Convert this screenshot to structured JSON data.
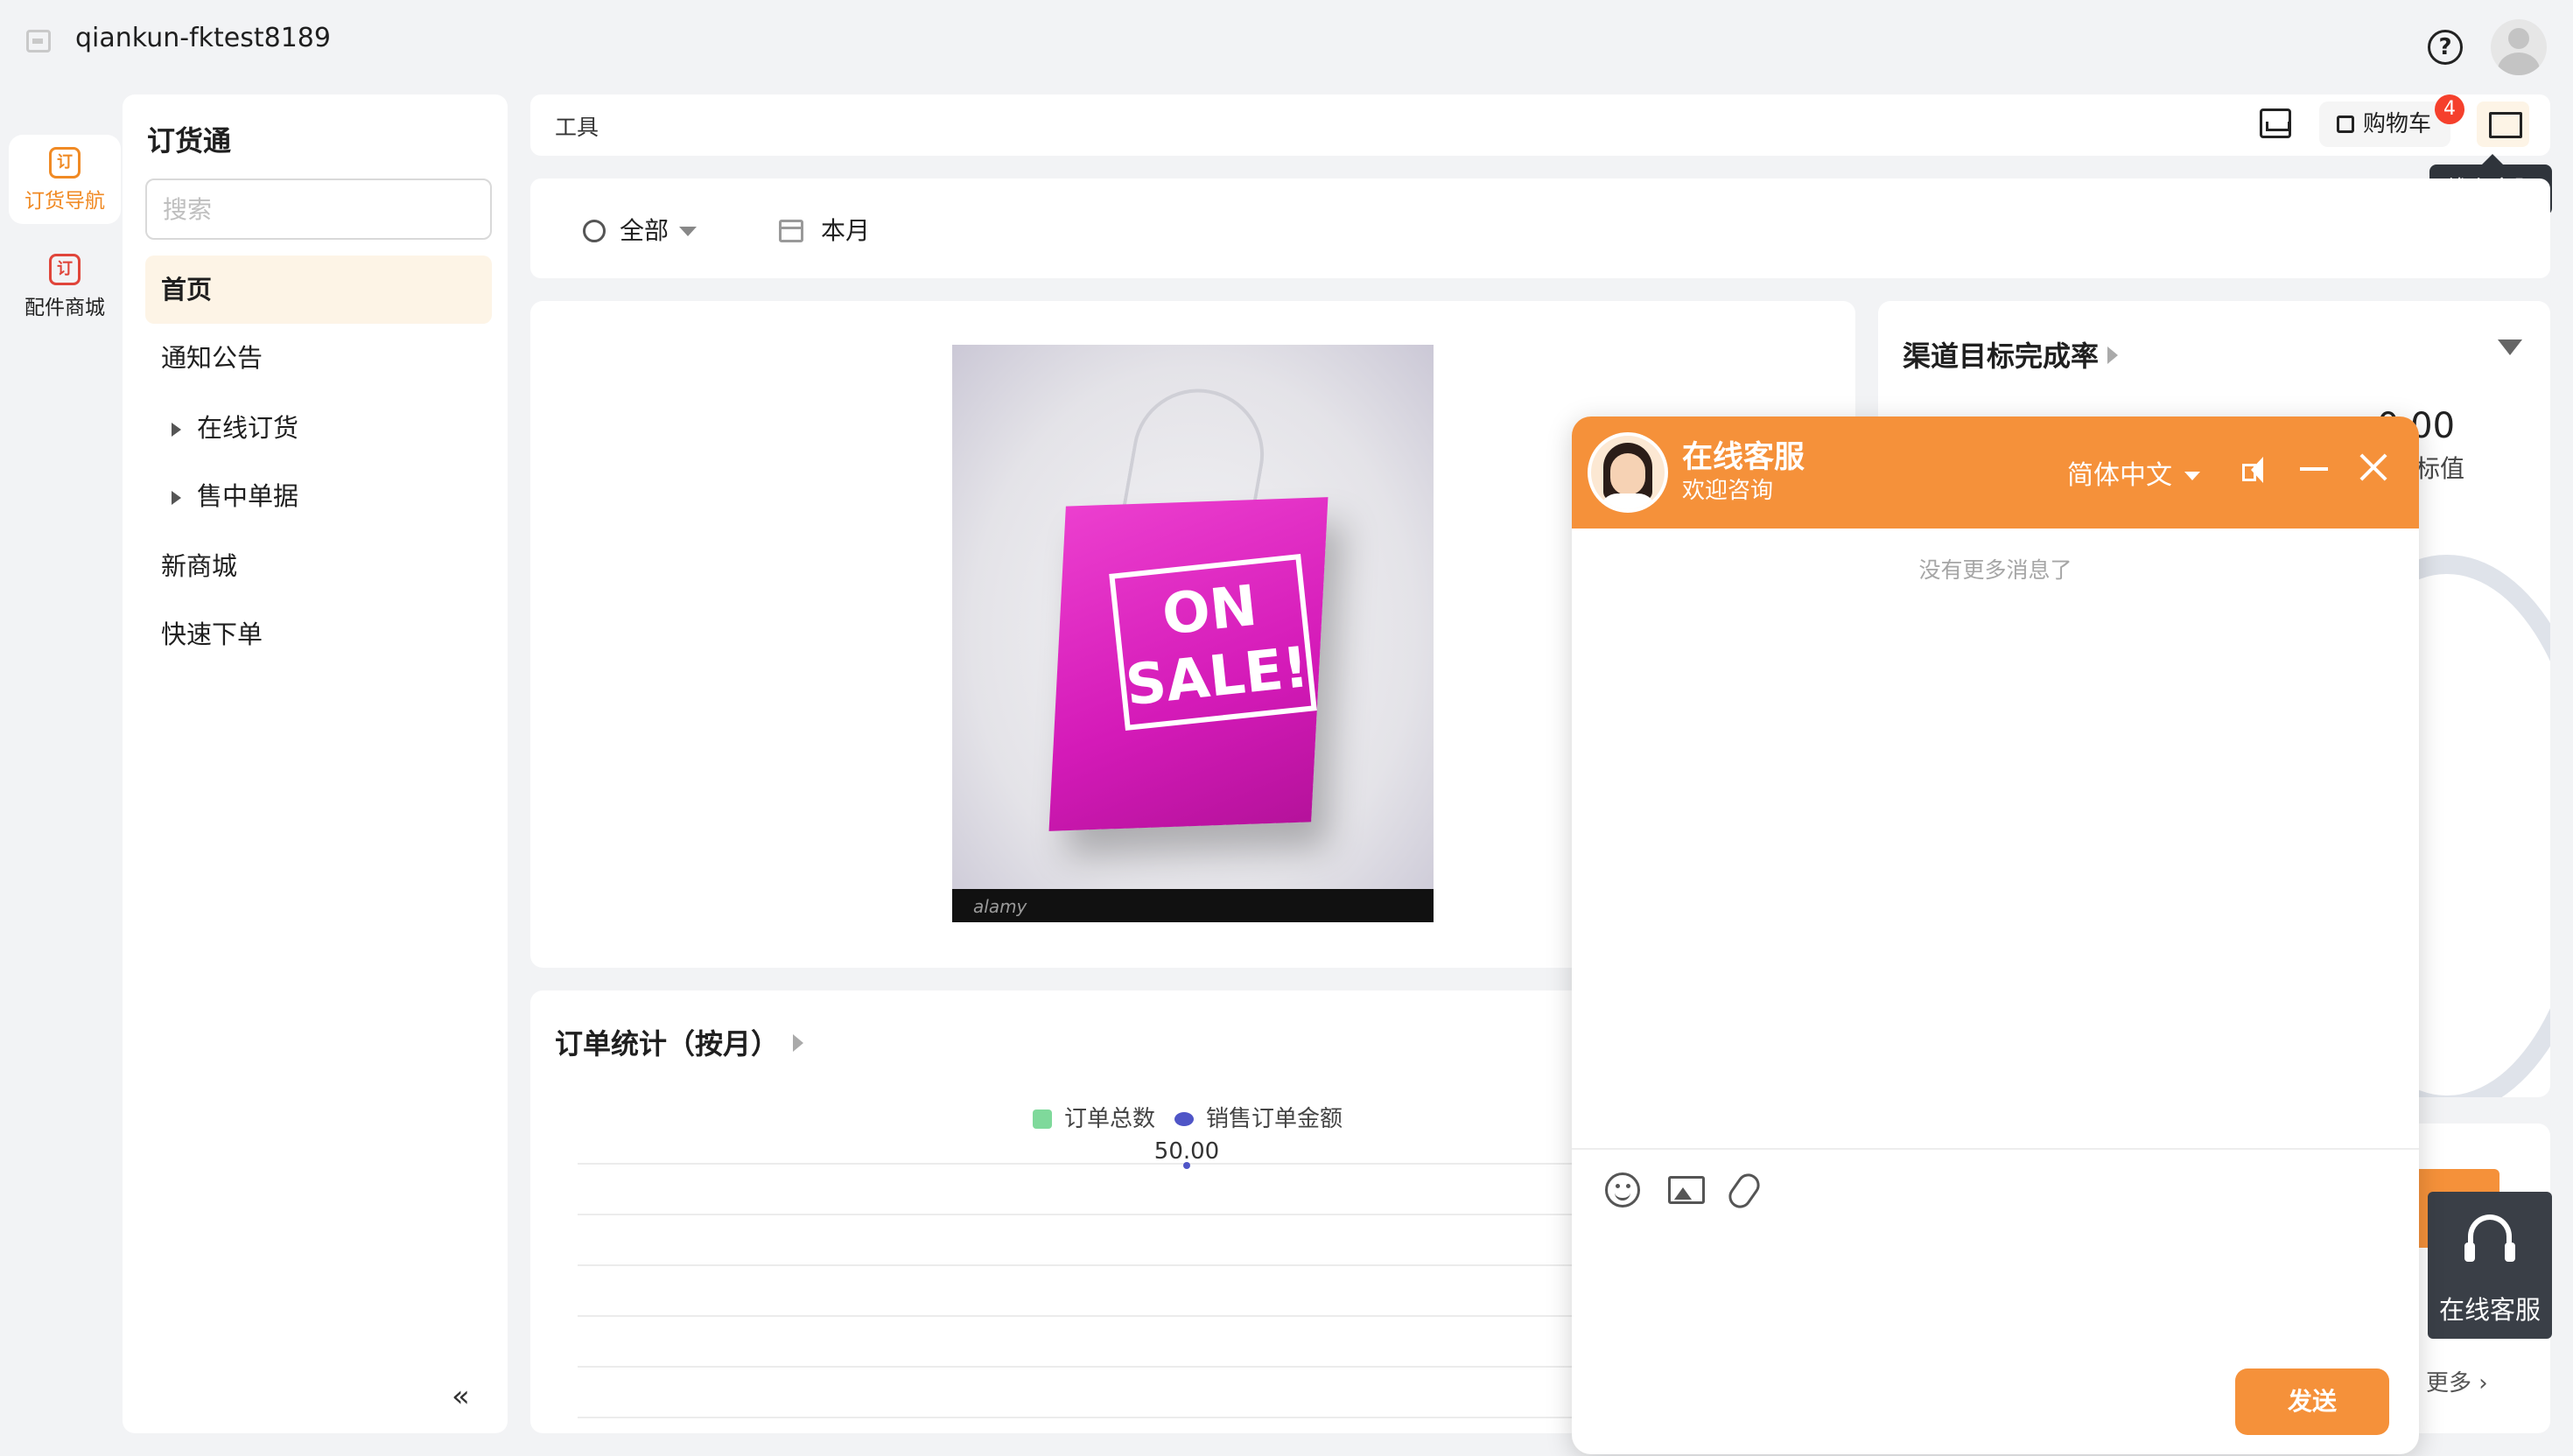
{
  "app": {
    "title": "qiankun-fktest8189"
  },
  "rail": {
    "items": [
      {
        "label": "订货导航",
        "icon": "order-nav-icon",
        "active": true
      },
      {
        "label": "配件商城",
        "icon": "parts-mall-icon",
        "active": false
      }
    ],
    "icon_glyph": "订"
  },
  "nav": {
    "title": "订货通",
    "search_placeholder": "搜索",
    "items": [
      {
        "label": "首页",
        "active": true
      },
      {
        "label": "通知公告"
      },
      {
        "label": "在线订货",
        "expandable": true
      },
      {
        "label": "售中单据",
        "expandable": true
      },
      {
        "label": "新商城"
      },
      {
        "label": "快速下单"
      }
    ],
    "collapse_glyph": "«"
  },
  "toolbar": {
    "label": "工具",
    "cart_label": "购物车",
    "cart_count": "4",
    "tooltip": "线上客服"
  },
  "filters": {
    "scope": "全部",
    "period": "本月"
  },
  "banner": {
    "sale_text_line1": "ON",
    "sale_text_line2": "SALE!",
    "watermark": "alamy"
  },
  "order_stats": {
    "title": "订单统计（按月）",
    "legend": [
      "订单总数",
      "销售订单金额"
    ]
  },
  "chart_data": {
    "type": "line",
    "title": "订单统计（按月）",
    "series": [
      {
        "name": "订单总数",
        "color": "#7fd99b",
        "values": []
      },
      {
        "name": "销售订单金额",
        "color": "#4f55c7",
        "values": [
          50.0
        ]
      }
    ],
    "data_labels": [
      "50.00"
    ],
    "grid": true
  },
  "rate_card": {
    "title": "渠道目标完成率",
    "value": "0.00",
    "value_label": "标值"
  },
  "more_card": {
    "more_label": "更多 ›"
  },
  "service_float": {
    "label": "在线客服"
  },
  "chat": {
    "title": "在线客服",
    "subtitle": "欢迎咨询",
    "language": "简体中文",
    "no_more": "没有更多消息了",
    "send_label": "发送"
  },
  "colors": {
    "accent": "#f5913a",
    "badge": "#f5402c",
    "active_nav_bg": "#fdf4e6"
  }
}
